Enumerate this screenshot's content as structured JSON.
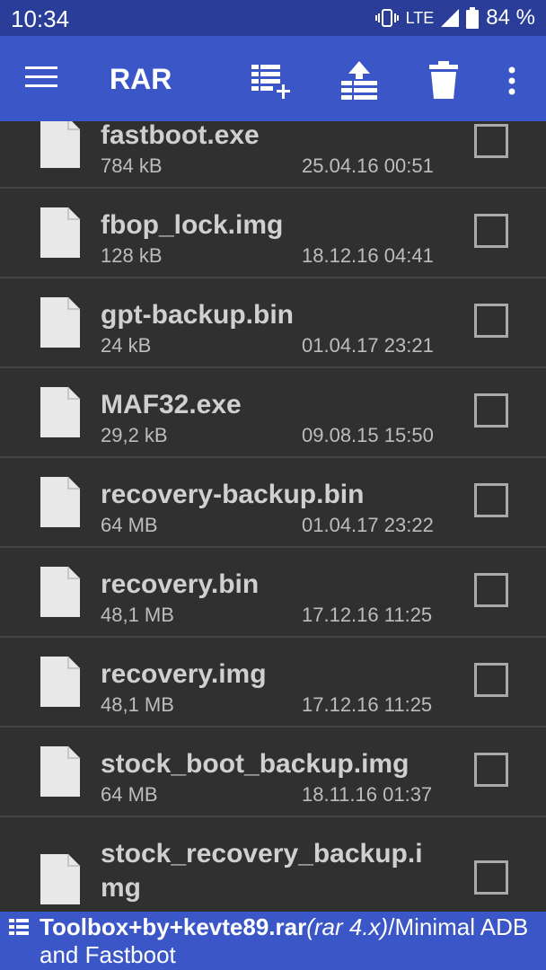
{
  "status": {
    "time": "10:34",
    "network": "LTE",
    "battery": "84 %"
  },
  "appbar": {
    "title": "RAR"
  },
  "files": [
    {
      "name": "fastboot.exe",
      "size": "784 kB",
      "date": "25.04.16 00:51"
    },
    {
      "name": "fbop_lock.img",
      "size": "128 kB",
      "date": "18.12.16 04:41"
    },
    {
      "name": "gpt-backup.bin",
      "size": "24 kB",
      "date": "01.04.17 23:21"
    },
    {
      "name": "MAF32.exe",
      "size": "29,2 kB",
      "date": "09.08.15 15:50"
    },
    {
      "name": "recovery-backup.bin",
      "size": "64 MB",
      "date": "01.04.17 23:22"
    },
    {
      "name": "recovery.bin",
      "size": "48,1 MB",
      "date": "17.12.16 11:25"
    },
    {
      "name": "recovery.img",
      "size": "48,1 MB",
      "date": "17.12.16 11:25"
    },
    {
      "name": "stock_boot_backup.img",
      "size": "64 MB",
      "date": "18.11.16 01:37"
    },
    {
      "name": "stock_recovery_backup.img",
      "size": "",
      "date": ""
    }
  ],
  "footer": {
    "archive": "Toolbox+by+kevte89.rar",
    "format": "(rar 4.x)",
    "path": "/Minimal ADB and Fastboot"
  }
}
